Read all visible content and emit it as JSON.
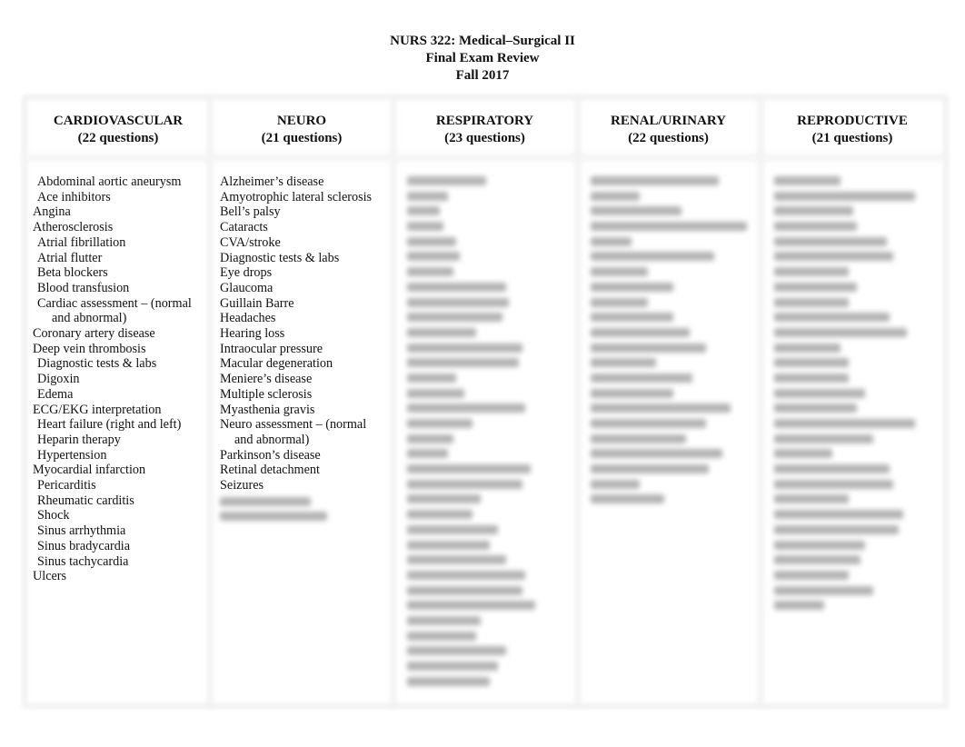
{
  "header": {
    "course": "NURS 322: Medical–Surgical II",
    "subtitle": "Final Exam Review",
    "term": "Fall 2017"
  },
  "columns": [
    {
      "title": "CARDIOVASCULAR",
      "count": "(22 questions)",
      "items": [
        {
          "text": "Abdominal aortic aneurysm",
          "indent": true
        },
        {
          "text": "Ace inhibitors",
          "indent": true
        },
        {
          "text": "Angina",
          "indent": false
        },
        {
          "text": "Atherosclerosis",
          "indent": false
        },
        {
          "text": "Atrial fibrillation",
          "indent": true
        },
        {
          "text": "Atrial flutter",
          "indent": true
        },
        {
          "text": "Beta blockers",
          "indent": true
        },
        {
          "text": "Blood transfusion",
          "indent": true
        },
        {
          "text": "Cardiac assessment – (normal",
          "cont": "and abnormal)",
          "indent": true
        },
        {
          "text": "Coronary artery disease",
          "indent": false
        },
        {
          "text": "Deep vein thrombosis",
          "indent": false
        },
        {
          "text": "Diagnostic tests & labs",
          "indent": true
        },
        {
          "text": "Digoxin",
          "indent": true
        },
        {
          "text": "Edema",
          "indent": true
        },
        {
          "text": "ECG/EKG interpretation",
          "indent": false
        },
        {
          "text": "Heart failure (right and left)",
          "indent": true
        },
        {
          "text": "Heparin therapy",
          "indent": true
        },
        {
          "text": "Hypertension",
          "indent": true
        },
        {
          "text": "Myocardial infarction",
          "indent": false
        },
        {
          "text": "Pericarditis",
          "indent": true
        },
        {
          "text": "Rheumatic carditis",
          "indent": true
        },
        {
          "text": "Shock",
          "indent": true
        },
        {
          "text": "Sinus arrhythmia",
          "indent": true
        },
        {
          "text": "Sinus bradycardia",
          "indent": true
        },
        {
          "text": "Sinus tachycardia",
          "indent": true
        },
        {
          "text": "Ulcers",
          "indent": false
        }
      ]
    },
    {
      "title": "NEURO",
      "count": "(21 questions)",
      "items": [
        {
          "text": "Alzheimer’s disease",
          "indent": false
        },
        {
          "text": "Amyotrophic lateral sclerosis",
          "indent": false
        },
        {
          "text": "Bell’s palsy",
          "indent": false
        },
        {
          "text": "Cataracts",
          "indent": false
        },
        {
          "text": "CVA/stroke",
          "indent": false
        },
        {
          "text": "Diagnostic tests & labs",
          "indent": false
        },
        {
          "text": "Eye drops",
          "indent": false
        },
        {
          "text": "Glaucoma",
          "indent": false
        },
        {
          "text": "Guillain Barre",
          "indent": false
        },
        {
          "text": "Headaches",
          "indent": false
        },
        {
          "text": "Hearing loss",
          "indent": false
        },
        {
          "text": "Intraocular pressure",
          "indent": false
        },
        {
          "text": "Macular degeneration",
          "indent": false
        },
        {
          "text": "Meniere’s disease",
          "indent": false
        },
        {
          "text": "Multiple sclerosis",
          "indent": false
        },
        {
          "text": "Myasthenia gravis",
          "indent": false
        },
        {
          "text": "Neuro assessment – (normal",
          "cont": "and abnormal)",
          "indent": false
        },
        {
          "text": "Parkinson’s disease",
          "indent": false
        },
        {
          "text": "Retinal detachment",
          "indent": false
        },
        {
          "text": "Seizures",
          "indent": false
        }
      ],
      "blurred_lines": [
        0.55,
        0.65
      ]
    },
    {
      "title": "RESPIRATORY",
      "count": "(23 questions)",
      "items": [],
      "blurred_lines": [
        0.48,
        0.25,
        0.2,
        0.22,
        0.3,
        0.32,
        0.28,
        0.6,
        0.62,
        0.58,
        0.42,
        0.7,
        0.68,
        0.3,
        0.35,
        0.72,
        0.4,
        0.28,
        0.25,
        0.75,
        0.7,
        0.45,
        0.4,
        0.55,
        0.5,
        0.6,
        0.72,
        0.7,
        0.78,
        0.45,
        0.42,
        0.6,
        0.55,
        0.5
      ]
    },
    {
      "title": "RENAL/URINARY",
      "count": "(22 questions)",
      "items": [],
      "blurred_lines": [
        0.78,
        0.3,
        0.55,
        0.95,
        0.25,
        0.75,
        0.35,
        0.5,
        0.35,
        0.5,
        0.6,
        0.7,
        0.4,
        0.62,
        0.5,
        0.85,
        0.7,
        0.58,
        0.8,
        0.72,
        0.3,
        0.45
      ]
    },
    {
      "title": "REPRODUCTIVE",
      "count": "(21 questions)",
      "items": [],
      "blurred_lines": [
        0.4,
        0.85,
        0.48,
        0.5,
        0.68,
        0.72,
        0.45,
        0.5,
        0.45,
        0.7,
        0.8,
        0.4,
        0.45,
        0.45,
        0.55,
        0.5,
        0.85,
        0.6,
        0.35,
        0.7,
        0.72,
        0.45,
        0.78,
        0.75,
        0.55,
        0.52,
        0.45,
        0.6,
        0.3
      ]
    }
  ]
}
